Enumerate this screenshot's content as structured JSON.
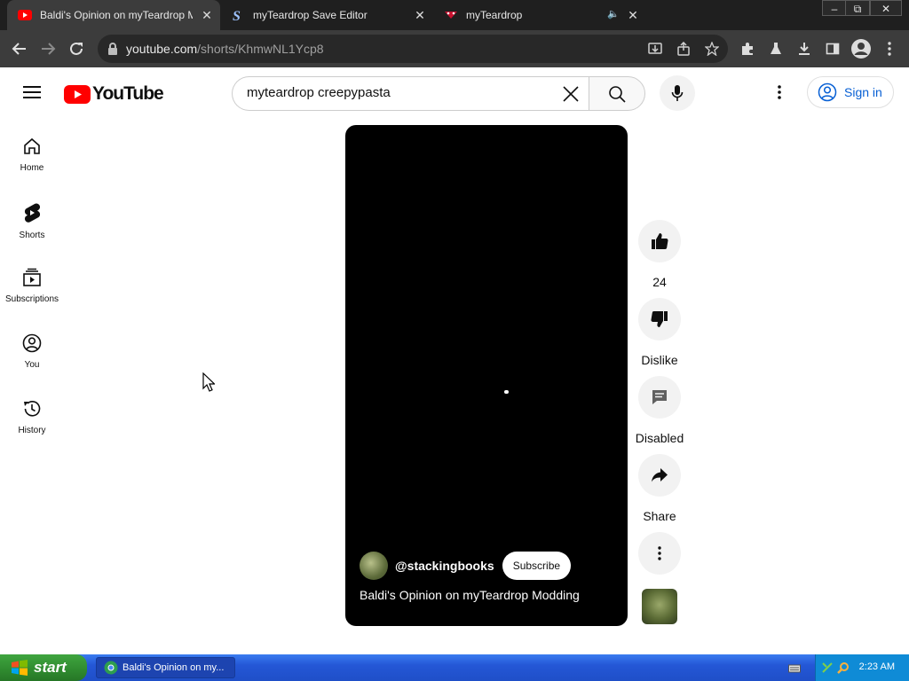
{
  "browser": {
    "tabs": [
      {
        "title": "Baldi's Opinion on myTeardrop Modding",
        "active": true
      },
      {
        "title": "myTeardrop Save Editor",
        "active": false
      },
      {
        "title": "myTeardrop",
        "active": false
      }
    ],
    "url_host": "youtube.com",
    "url_path": "/shorts/KhmwNL1Ycp8",
    "window_controls": {
      "minimize": "–",
      "restore": "⧉",
      "close": "✕"
    }
  },
  "youtube": {
    "logo_text": "YouTube",
    "search_value": "myteardrop creepypasta",
    "sign_in_label": "Sign in",
    "sidebar": [
      {
        "label": "Home",
        "icon": "home-icon"
      },
      {
        "label": "Shorts",
        "icon": "shorts-icon"
      },
      {
        "label": "Subscriptions",
        "icon": "subscriptions-icon"
      },
      {
        "label": "You",
        "icon": "you-icon"
      },
      {
        "label": "History",
        "icon": "history-icon"
      }
    ],
    "short": {
      "channel": "@stackingbooks",
      "subscribe_label": "Subscribe",
      "title": "Baldi's Opinion on myTeardrop Modding"
    },
    "actions": {
      "like_count": "24",
      "dislike_label": "Dislike",
      "comments_label": "Disabled",
      "share_label": "Share"
    }
  },
  "taskbar": {
    "start_label": "start",
    "task_label": "Baldi's Opinion on my...",
    "clock": "2:23 AM"
  },
  "colors": {
    "youtube_red": "#ff0000",
    "link_blue": "#065fd4",
    "xp_blue": "#245edb",
    "xp_green": "#2f8a2f"
  }
}
